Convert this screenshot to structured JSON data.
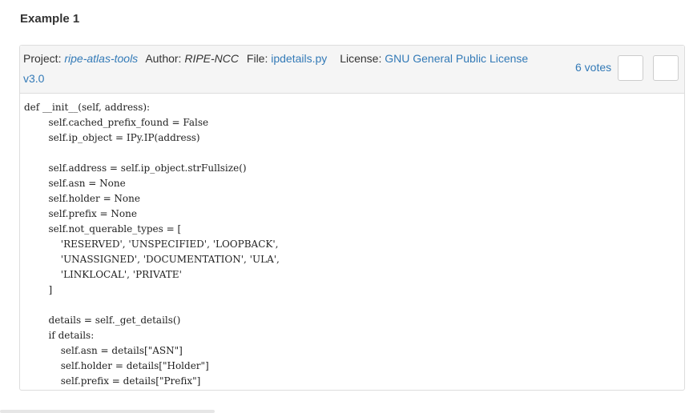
{
  "example": {
    "title": "Example 1"
  },
  "header": {
    "project_label": "Project:",
    "project_name": "ripe-atlas-tools",
    "author_label": "Author:",
    "author_name": "RIPE-NCC",
    "file_label": "File:",
    "file_name": "ipdetails.py",
    "license_label": "License:",
    "license_name": "GNU General Public License v3.0",
    "votes": "6 votes"
  },
  "code": {
    "lines": [
      "def __init__(self, address):",
      "        self.cached_prefix_found = False",
      "        self.ip_object = IPy.IP(address)",
      "",
      "        self.address = self.ip_object.strFullsize()",
      "        self.asn = None",
      "        self.holder = None",
      "        self.prefix = None",
      "        self.not_querable_types = [",
      "            'RESERVED', 'UNSPECIFIED', 'LOOPBACK',",
      "            'UNASSIGNED', 'DOCUMENTATION', 'ULA',",
      "            'LINKLOCAL', 'PRIVATE'",
      "        ]",
      "",
      "        details = self._get_details()",
      "        if details:",
      "            self.asn = details[\"ASN\"]",
      "            self.holder = details[\"Holder\"]",
      "            self.prefix = details[\"Prefix\"]"
    ]
  },
  "colors": {
    "link": "#337ab7",
    "header_bg": "#f5f5f5",
    "border": "#dddddd"
  }
}
